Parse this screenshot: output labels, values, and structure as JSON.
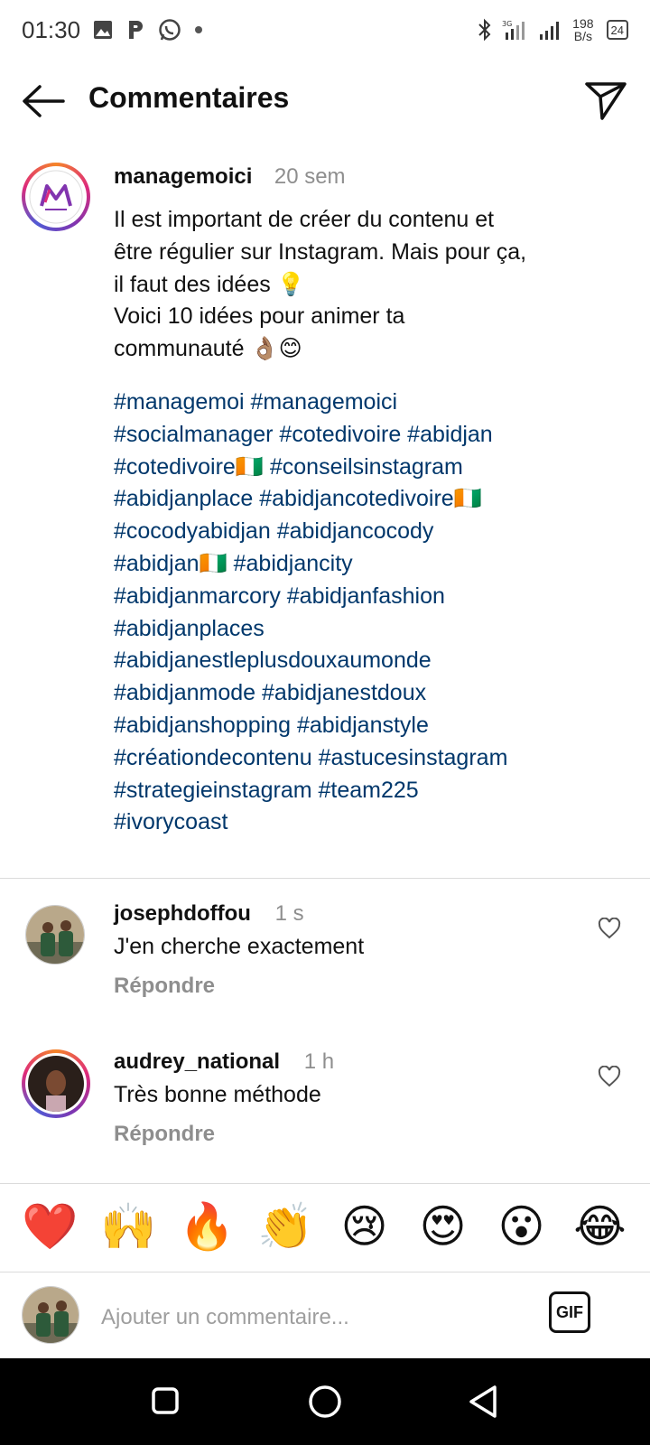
{
  "status_bar": {
    "time": "01:30",
    "net_speed_value": "198",
    "net_speed_unit": "B/s",
    "battery": "24"
  },
  "header": {
    "title": "Commentaires"
  },
  "post": {
    "username": "managemoici",
    "time": "20 sem",
    "text_lines": [
      "Il est important de créer du contenu et",
      "être régulier sur Instagram. Mais pour ça,",
      "il faut des idées 💡",
      "Voici 10 idées pour animer ta",
      "communauté 👌🏽😊"
    ],
    "hashtag_lines": [
      "#managemoi #managemoici",
      "#socialmanager #cotedivoire #abidjan",
      "#cotedivoire🇨🇮 #conseilsinstagram",
      "#abidjanplace #abidjancotedivoire🇨🇮",
      "#cocodyabidjan #abidjancocody",
      "#abidjan🇨🇮 #abidjancity",
      "#abidjanmarcory #abidjanfashion",
      "#abidjanplaces",
      "#abidjanestleplusdouxaumonde",
      "#abidjanmode #abidjanestdoux",
      "#abidjanshopping #abidjanstyle",
      "#créationdecontenu #astucesinstagram",
      "#strategieinstagram #team225",
      "#ivorycoast"
    ]
  },
  "comments": [
    {
      "username": "josephdoffou",
      "time": "1 s",
      "text": "J'en cherche exactement",
      "reply": "Répondre"
    },
    {
      "username": "audrey_national",
      "time": "1 h",
      "text": "Très bonne méthode",
      "reply": "Répondre"
    }
  ],
  "emoji_bar": [
    "❤️",
    "🙌",
    "🔥",
    "👏",
    "😢",
    "😍",
    "😮",
    "😂"
  ],
  "composer": {
    "placeholder": "Ajouter un commentaire...",
    "gif_label": "GIF"
  },
  "colors": {
    "hashtag": "#00376b",
    "muted": "#8e8e8e",
    "divider": "#dbdbdb"
  }
}
